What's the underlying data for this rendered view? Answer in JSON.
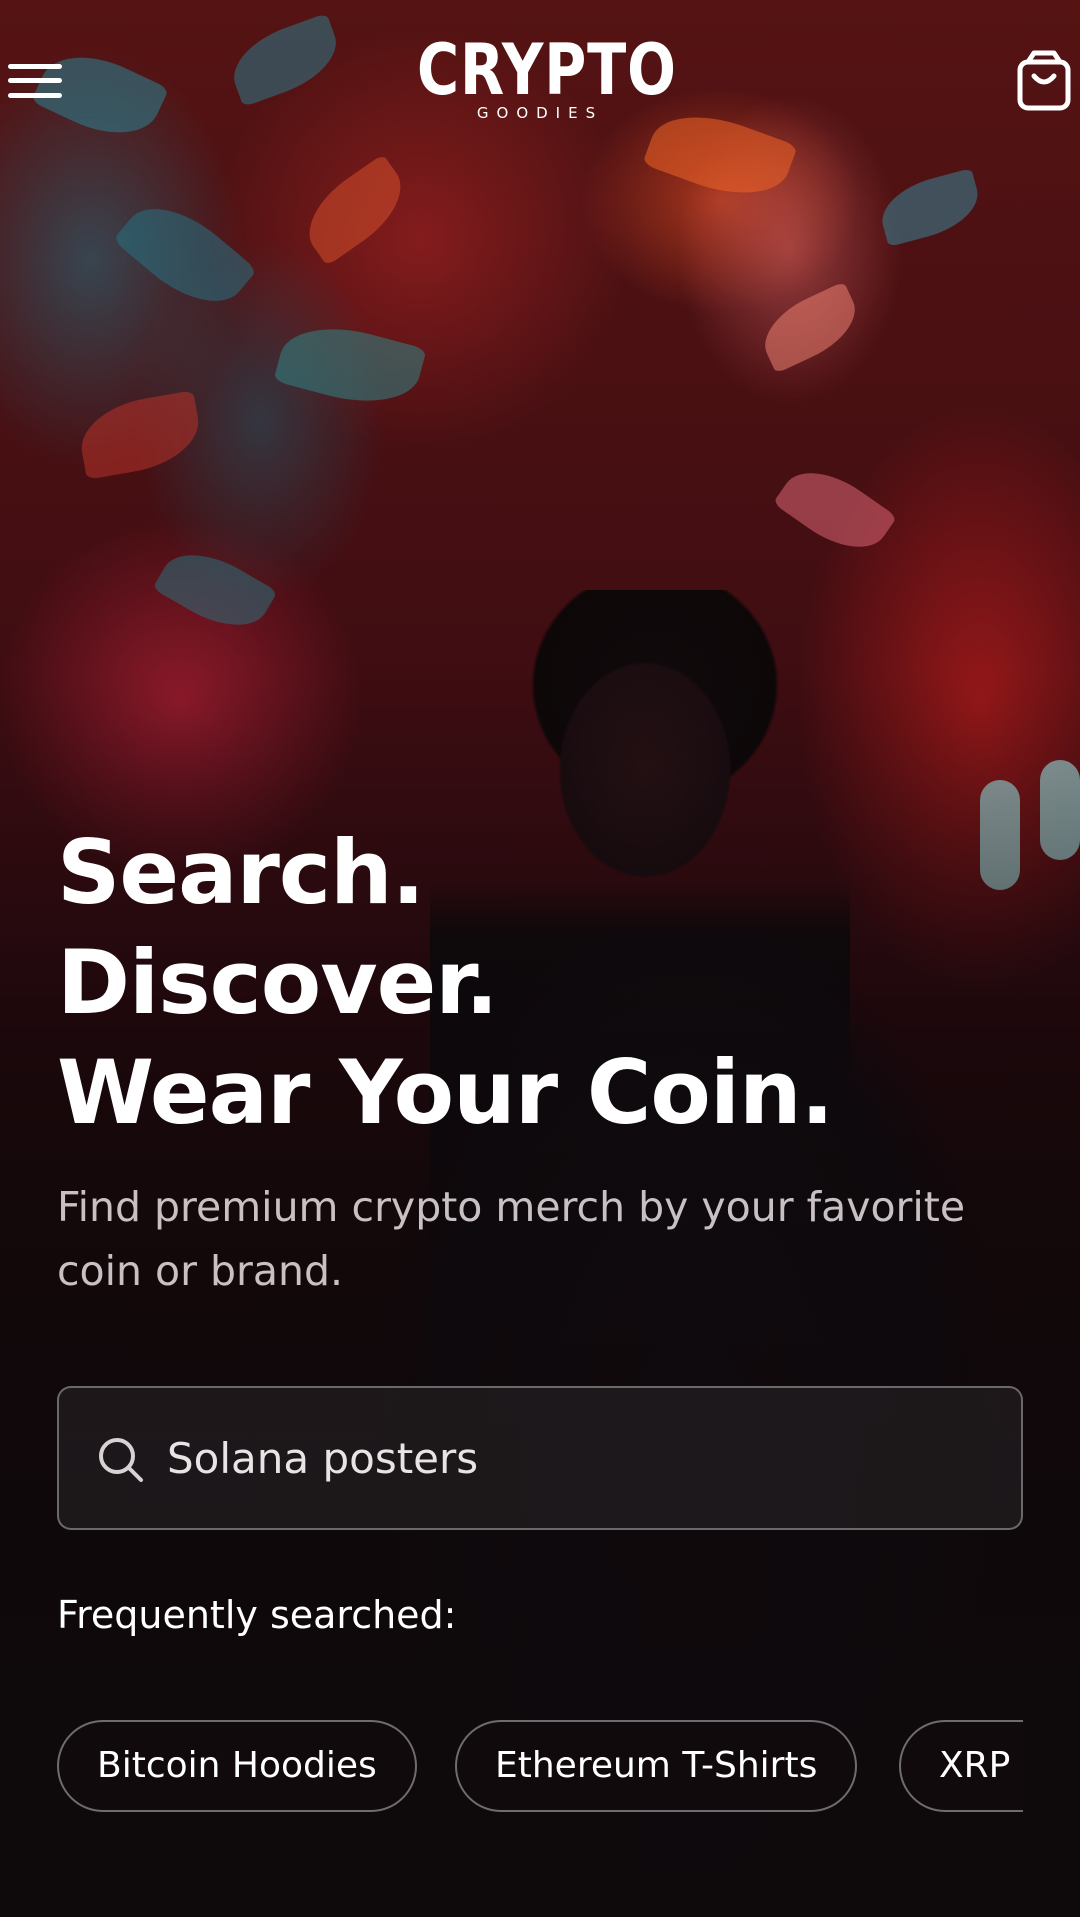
{
  "header": {
    "logo_main": "CRYPTO",
    "logo_sub": "GOODIES",
    "menu_icon": "hamburger-menu-icon",
    "cart_icon": "shopping-bag-icon"
  },
  "hero": {
    "headline_lines": [
      "Search.",
      "Discover.",
      "Wear Your Coin."
    ],
    "subtext": "Find premium crypto merch by your favorite coin or brand."
  },
  "search": {
    "icon": "search-icon",
    "value": "Solana posters"
  },
  "frequent": {
    "label": "Frequently searched:",
    "chips": [
      "Bitcoin Hoodies",
      "Ethereum T-Shirts",
      "XRP I"
    ]
  },
  "colors": {
    "text_primary": "#ffffff",
    "text_secondary": "#c8c0c2",
    "background_dark": "#120a0c",
    "accent_red": "#c81e1e"
  }
}
